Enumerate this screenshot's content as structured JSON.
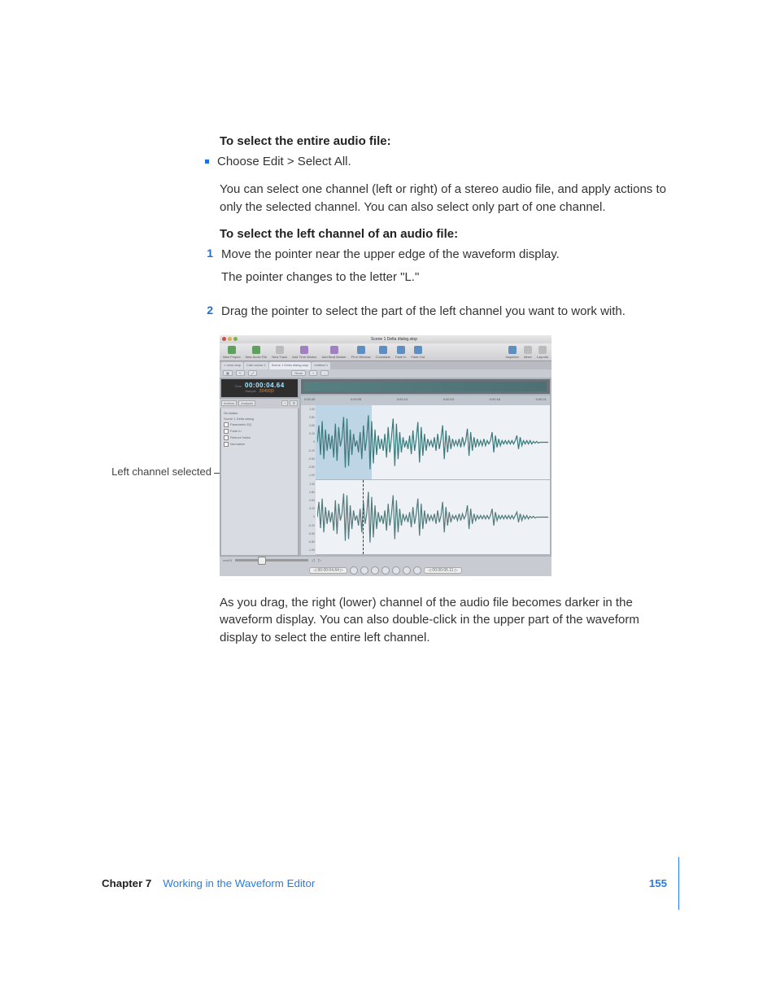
{
  "body": {
    "heading1": "To select the entire audio file:",
    "bullet1": "Choose Edit > Select All.",
    "para1": "You can select one channel (left or right) of a stereo audio file, and apply actions to only the selected channel. You can also select only part of one channel.",
    "heading2": "To select the left channel of an audio file:",
    "steps": {
      "s1": {
        "n": "1",
        "a": "Move the pointer near the upper edge of the waveform display.",
        "b": "The pointer changes to the letter \"L.\""
      },
      "s2": {
        "n": "2",
        "a": "Drag the pointer to select the part of the left channel you want to work with."
      }
    },
    "callout": "Left channel selected",
    "para2": "As you drag, the right (lower) channel of the audio file becomes darker in the waveform display. You can also double-click in the upper part of the waveform display to select the entire left channel."
  },
  "app": {
    "title": "Scene 1 Delta dialog.stop",
    "toolbar": [
      "New Project",
      "New Audio File",
      "New Track",
      "Add Time Marker",
      "Add Beat Marker",
      "Fit in Window",
      "Crossfade",
      "Fade In",
      "Fade Out",
      "Inspector",
      "Mixer",
      "Layouts"
    ],
    "tabs": [
      "< none.stop",
      "Cafe scene 1",
      "Scene 1 Delta dialog.stop",
      "Untitled 1"
    ],
    "subbar": {
      "read": "Read",
      "plus": "+",
      "minus": "–"
    },
    "time": {
      "tc": "00:00:04.64",
      "beats": "20450|0",
      "label1": "Time",
      "label2": "Sample"
    },
    "actions": {
      "tabs": [
        "Actions",
        "Analysis"
      ],
      "header": "On   Action",
      "items": [
        "Scene 1 Delta dialog",
        "Parametric EQ",
        "Fade In",
        "Reduce Noise",
        "Normalize"
      ]
    },
    "ruler": [
      "0:00.00",
      "0:00:05",
      "0:00:10",
      "0:00:15",
      "0:00:18",
      "0:00:21"
    ],
    "scale": [
      "1.00",
      "0.80",
      "0.60",
      "0.20",
      "0",
      "-0.20",
      "-0.60",
      "-0.80",
      "-1.00",
      "1.00",
      "0.80",
      "0.60",
      "0.20",
      "0",
      "-0.20",
      "-0.60",
      "-0.80",
      "-1.00"
    ],
    "counters": {
      "l": "00:00:04.64",
      "r": "00:00:05.11"
    },
    "sliderLabel": "one03"
  },
  "footer": {
    "chapter": "Chapter 7",
    "title": "Working in the Waveform Editor",
    "page": "155"
  }
}
